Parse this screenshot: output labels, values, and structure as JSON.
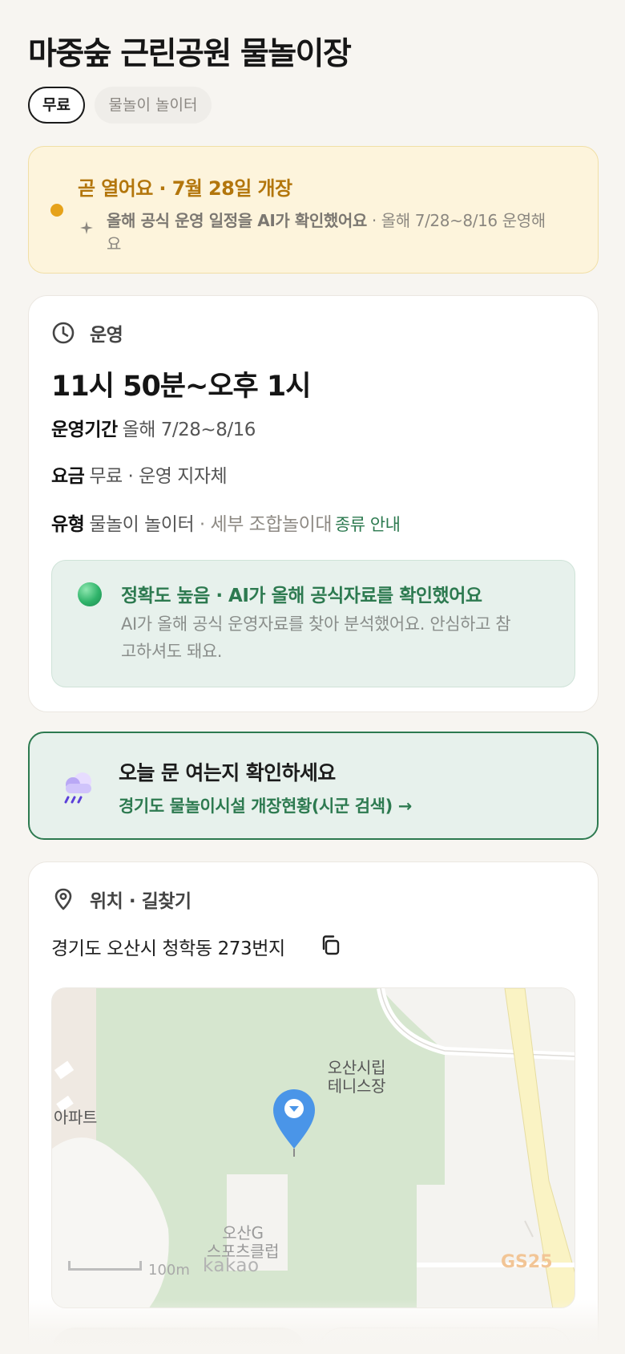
{
  "header": {
    "title": "마중숲 근린공원 물놀이장",
    "tags": {
      "price": "무료",
      "type": "물놀이 놀이터"
    }
  },
  "notice": {
    "status": "곧 열어요 · 7월 28일 개장",
    "ai_check": "올해 공식 운영 일정을 AI가 확인했어요",
    "detail": " · 올해 7/28~8/16 운영해요",
    "dot_color": "#e6a21a"
  },
  "operation": {
    "section_label": "운영",
    "hours": "11시 50분~오후 1시",
    "period_key": "운영기간",
    "period_value": "올해 7/28~8/16",
    "fee_key": "요금",
    "fee_value": "무료 · 운영 지자체",
    "type_key": "유형",
    "type_value": "물놀이 놀이터",
    "type_detail": " · 세부 조합놀이대",
    "type_link": "종류 안내",
    "accuracy": {
      "title": "정확도 높음 · AI가 올해 공식자료를 확인했어요",
      "body": "AI가 올해 공식 운영자료를 찾아 분석했어요. 안심하고 참고하셔도 돼요."
    }
  },
  "today_check": {
    "title": "오늘 문 여는지 확인하세요",
    "link": "경기도 물놀이시설 개장현황(시군 검색) →",
    "icon": "rain-cloud-icon"
  },
  "location": {
    "section_label": "위치 · 길찾기",
    "address": "경기도 오산시 청학동 273번지",
    "map": {
      "label_tennis": "오산시립\n테니스장",
      "label_apt": "아파트",
      "label_sports": "오산G\n스포츠클럽",
      "scale": "100m",
      "brand": "kakao",
      "gs": "GS25"
    }
  },
  "colors": {
    "accent_green": "#2d7a50",
    "notice_orange": "#b3760c",
    "background": "#f7f5f1"
  }
}
